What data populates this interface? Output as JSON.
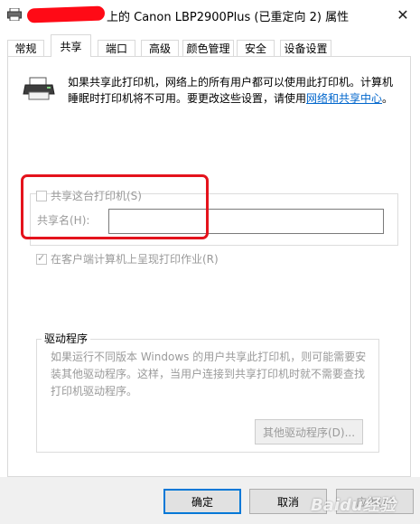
{
  "window": {
    "title": "上的 Canon LBP2900Plus (已重定向 2) 属性",
    "close_glyph": "✕"
  },
  "tabs": [
    {
      "label": "常规",
      "active": false
    },
    {
      "label": "共享",
      "active": true
    },
    {
      "label": "端口",
      "active": false
    },
    {
      "label": "高级",
      "active": false
    },
    {
      "label": "颜色管理",
      "active": false
    },
    {
      "label": "安全",
      "active": false
    },
    {
      "label": "设备设置",
      "active": false
    }
  ],
  "sharing": {
    "description_part1": "如果共享此打印机，网络上的所有用户都可以使用此打印机。计算机睡眠时打印机将不可用。要更改这些设置，请使用",
    "description_link": "网络和共享中心",
    "description_end": "。",
    "share_checkbox_label": "共享这台打印机(S)",
    "share_checked": false,
    "share_name_label": "共享名(H):",
    "share_name_value": "",
    "render_checkbox_label": "在客户端计算机上呈现打印作业(R)",
    "render_checked": true
  },
  "drivers": {
    "group_label": "驱动程序",
    "description": "如果运行不同版本 Windows 的用户共享此打印机，则可能需要安装其他驱动程序。这样，当用户连接到共享打印机时就不需要查找打印机驱动程序。",
    "button_label": "其他驱动程序(D)..."
  },
  "buttons": {
    "ok": "确定",
    "cancel": "取消",
    "apply": "应用(A)"
  },
  "watermark": "Baidu经验",
  "colors": {
    "accent": "#0078d7",
    "highlight_box": "#e4131c",
    "redaction": "#ff0a16",
    "disabled_text": "#9a9a9a",
    "link": "#0066cc"
  }
}
